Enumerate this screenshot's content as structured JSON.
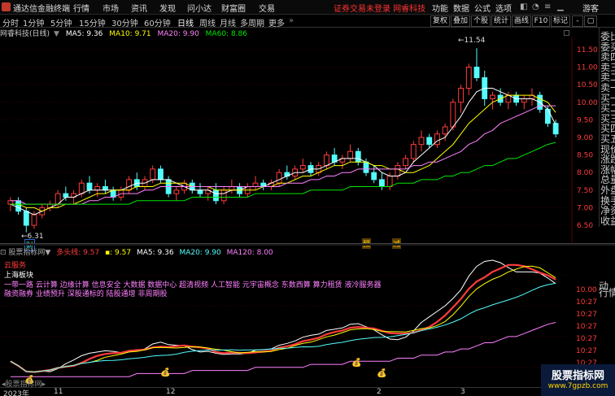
{
  "app": {
    "title": "通达信金融终端"
  },
  "menu": [
    "行情",
    "市场",
    "资讯",
    "发现",
    "问小达",
    "财富圈",
    "交易"
  ],
  "login_text": "证券交易未登录",
  "login_broker": "网睿科技",
  "menu_right": [
    "功能",
    "数据",
    "公式",
    "选项"
  ],
  "guest": "游客",
  "periods": [
    "分时",
    "1分钟",
    "5分钟",
    "15分钟",
    "30分钟",
    "60分钟",
    "日线",
    "周线",
    "月线",
    "多周期",
    "更多"
  ],
  "toolbar_right": [
    "复权",
    "叠加",
    "个股",
    "统计",
    "画线",
    "F10",
    "标记"
  ],
  "main_header": {
    "stock": "网睿科技(日线)",
    "ma5": "MA5: 9.36",
    "ma10": "MA10: 9.71",
    "ma20": "MA20: 9.90",
    "ma60": "MA60: 8.86"
  },
  "price_axis": [
    "11.50",
    "11.00",
    "10.50",
    "10.00",
    "9.50",
    "9.00",
    "8.50",
    "8.00",
    "7.50",
    "7.00",
    "6.50"
  ],
  "annotations": {
    "high": "11.54",
    "low": "6.31",
    "caibao": "财",
    "yu": "预",
    "jian": "减"
  },
  "right_labels": [
    "委比",
    "委买",
    "卖四",
    "卖三",
    "卖二",
    "卖一",
    "买一",
    "买二",
    "买三",
    "买四",
    "买五",
    "现价",
    "涨跌",
    "涨幅",
    "总量",
    "外盘",
    "换手",
    "净资",
    "收益"
  ],
  "low_header": {
    "name": "股票指标网",
    "indicator": "多头线",
    "v1": ": 9.57",
    "v2": ": 9.57",
    "ma5": "MA5: 9.36",
    "ma20": "MA20: 9.90",
    "ma120": "MA120: 8.00"
  },
  "low_overlay": {
    "l1": "云服务",
    "l2": "上海板块",
    "l3": "一带一路  云计算  边缘计算  信息安全  大数据  数据中心  超清视频  人工智能  元宇宙概念  东数西算  算力租赁  液冷服务器",
    "l4": "融资融券  业绩预升  深股通标的  陆股通增  非周期股"
  },
  "low_axis": [
    "10.00",
    "10:27",
    "10:27",
    "10:27",
    "10:27",
    "10:27",
    "10:27",
    "10:27",
    "10:27"
  ],
  "low_right": [
    "动",
    "行情"
  ],
  "bottom": {
    "year": "2023年",
    "m11": "11",
    "m12": "12",
    "m2": "2",
    "m3": "3",
    "pager": "股票指标网"
  },
  "watermark": {
    "line1": "股票指标网",
    "line2": "www.7gpzb.com"
  },
  "colors": {
    "up": "#ff3c3c",
    "down": "#54fcfc",
    "ma5": "#ffffff",
    "ma10": "#ffff00",
    "ma20": "#ff80ff",
    "ma60": "#00e600"
  },
  "chart_data": {
    "type": "candlestick",
    "ylim": [
      6.2,
      11.8
    ],
    "candles_ohlc": [
      [
        7.1,
        7.3,
        6.9,
        7.2
      ],
      [
        7.2,
        7.3,
        6.8,
        6.9
      ],
      [
        6.9,
        7.0,
        6.3,
        6.5
      ],
      [
        6.5,
        6.9,
        6.4,
        6.8
      ],
      [
        6.8,
        7.1,
        6.7,
        7.0
      ],
      [
        7.0,
        7.2,
        6.9,
        7.1
      ],
      [
        7.1,
        7.5,
        7.0,
        7.4
      ],
      [
        7.4,
        7.6,
        7.2,
        7.3
      ],
      [
        7.3,
        7.5,
        7.1,
        7.4
      ],
      [
        7.4,
        7.8,
        7.3,
        7.7
      ],
      [
        7.7,
        7.9,
        7.4,
        7.5
      ],
      [
        7.5,
        7.7,
        7.3,
        7.6
      ],
      [
        7.6,
        7.8,
        7.4,
        7.5
      ],
      [
        7.5,
        7.6,
        7.2,
        7.3
      ],
      [
        7.3,
        7.6,
        7.2,
        7.5
      ],
      [
        7.5,
        7.9,
        7.4,
        7.8
      ],
      [
        7.8,
        8.0,
        7.5,
        7.6
      ],
      [
        7.6,
        7.9,
        7.5,
        7.8
      ],
      [
        7.8,
        8.2,
        7.7,
        8.1
      ],
      [
        8.1,
        8.2,
        7.7,
        7.8
      ],
      [
        7.8,
        7.9,
        7.3,
        7.4
      ],
      [
        7.4,
        7.6,
        7.2,
        7.5
      ],
      [
        7.5,
        7.8,
        7.4,
        7.7
      ],
      [
        7.7,
        7.8,
        7.4,
        7.5
      ],
      [
        7.5,
        7.7,
        7.3,
        7.4
      ],
      [
        7.4,
        7.6,
        7.2,
        7.5
      ],
      [
        7.5,
        7.7,
        7.1,
        7.2
      ],
      [
        7.2,
        7.6,
        7.1,
        7.5
      ],
      [
        7.5,
        7.8,
        7.4,
        7.6
      ],
      [
        7.6,
        7.7,
        7.3,
        7.4
      ],
      [
        7.4,
        7.7,
        7.3,
        7.6
      ],
      [
        7.6,
        7.9,
        7.5,
        7.7
      ],
      [
        7.7,
        7.8,
        7.5,
        7.6
      ],
      [
        7.6,
        7.8,
        7.5,
        7.7
      ],
      [
        7.7,
        8.1,
        7.6,
        8.0
      ],
      [
        8.0,
        8.2,
        7.8,
        7.9
      ],
      [
        7.9,
        8.2,
        7.8,
        8.1
      ],
      [
        8.1,
        8.4,
        8.0,
        8.2
      ],
      [
        8.2,
        8.3,
        7.9,
        8.0
      ],
      [
        8.0,
        8.3,
        7.9,
        8.2
      ],
      [
        8.2,
        8.6,
        8.1,
        8.5
      ],
      [
        8.5,
        8.7,
        8.2,
        8.3
      ],
      [
        8.3,
        8.5,
        8.1,
        8.4
      ],
      [
        8.4,
        8.8,
        8.3,
        8.6
      ],
      [
        8.6,
        8.7,
        8.2,
        8.3
      ],
      [
        8.3,
        8.4,
        7.9,
        8.0
      ],
      [
        8.0,
        8.2,
        7.7,
        7.8
      ],
      [
        7.8,
        8.0,
        7.5,
        7.6
      ],
      [
        7.6,
        8.0,
        7.5,
        7.9
      ],
      [
        7.9,
        8.3,
        7.8,
        8.2
      ],
      [
        8.2,
        8.5,
        8.1,
        8.4
      ],
      [
        8.4,
        8.9,
        8.3,
        8.8
      ],
      [
        8.8,
        9.2,
        8.6,
        9.0
      ],
      [
        9.0,
        9.1,
        8.7,
        8.8
      ],
      [
        8.8,
        9.2,
        8.7,
        9.1
      ],
      [
        9.1,
        9.4,
        8.9,
        9.3
      ],
      [
        9.3,
        10.1,
        9.2,
        10.0
      ],
      [
        10.0,
        10.5,
        9.7,
        10.4
      ],
      [
        10.4,
        11.1,
        10.2,
        11.0
      ],
      [
        11.0,
        11.54,
        10.6,
        10.7
      ],
      [
        10.7,
        10.9,
        9.9,
        10.1
      ],
      [
        10.1,
        10.3,
        9.8,
        10.2
      ],
      [
        10.2,
        10.4,
        9.9,
        10.0
      ],
      [
        10.0,
        10.3,
        9.8,
        10.2
      ],
      [
        10.2,
        10.3,
        9.9,
        10.0
      ],
      [
        10.0,
        10.2,
        9.8,
        10.1
      ],
      [
        10.1,
        10.4,
        9.9,
        10.2
      ],
      [
        10.2,
        10.3,
        9.7,
        9.8
      ],
      [
        9.8,
        9.9,
        9.3,
        9.4
      ],
      [
        9.4,
        9.5,
        9.0,
        9.1
      ]
    ],
    "series": [
      {
        "name": "MA5",
        "values": [
          7.1,
          7.0,
          6.9,
          6.8,
          6.9,
          7.0,
          7.1,
          7.3,
          7.3,
          7.4,
          7.5,
          7.5,
          7.5,
          7.5,
          7.5,
          7.6,
          7.7,
          7.7,
          7.8,
          7.8,
          7.8,
          7.7,
          7.6,
          7.5,
          7.5,
          7.5,
          7.4,
          7.4,
          7.5,
          7.5,
          7.6,
          7.6,
          7.6,
          7.7,
          7.8,
          7.9,
          8.0,
          8.0,
          8.1,
          8.1,
          8.2,
          8.3,
          8.4,
          8.4,
          8.4,
          8.3,
          8.2,
          8.0,
          7.9,
          7.9,
          8.0,
          8.3,
          8.5,
          8.7,
          8.9,
          9.0,
          9.3,
          9.6,
          10.0,
          10.3,
          10.4,
          10.4,
          10.3,
          10.2,
          10.1,
          10.1,
          10.1,
          10.0,
          9.8,
          9.36
        ]
      },
      {
        "name": "MA10",
        "values": [
          7.1,
          7.1,
          7.0,
          7.0,
          6.9,
          7.0,
          7.0,
          7.1,
          7.1,
          7.2,
          7.3,
          7.4,
          7.4,
          7.5,
          7.5,
          7.5,
          7.6,
          7.6,
          7.6,
          7.7,
          7.7,
          7.7,
          7.7,
          7.6,
          7.6,
          7.6,
          7.5,
          7.5,
          7.5,
          7.5,
          7.5,
          7.5,
          7.6,
          7.6,
          7.7,
          7.7,
          7.8,
          7.9,
          7.9,
          8.0,
          8.1,
          8.2,
          8.2,
          8.3,
          8.3,
          8.3,
          8.2,
          8.2,
          8.1,
          8.1,
          8.0,
          8.0,
          8.1,
          8.2,
          8.4,
          8.6,
          8.8,
          9.1,
          9.4,
          9.6,
          9.8,
          10.0,
          10.1,
          10.2,
          10.2,
          10.2,
          10.2,
          10.1,
          10.0,
          9.71
        ]
      },
      {
        "name": "MA20",
        "values": [
          7.2,
          7.2,
          7.1,
          7.1,
          7.1,
          7.1,
          7.1,
          7.1,
          7.1,
          7.1,
          7.2,
          7.2,
          7.3,
          7.3,
          7.4,
          7.4,
          7.4,
          7.5,
          7.5,
          7.6,
          7.6,
          7.6,
          7.6,
          7.6,
          7.6,
          7.6,
          7.6,
          7.6,
          7.6,
          7.6,
          7.6,
          7.6,
          7.6,
          7.6,
          7.6,
          7.7,
          7.7,
          7.7,
          7.8,
          7.8,
          7.9,
          7.9,
          8.0,
          8.0,
          8.1,
          8.1,
          8.1,
          8.1,
          8.1,
          8.1,
          8.1,
          8.2,
          8.2,
          8.3,
          8.3,
          8.4,
          8.5,
          8.6,
          8.8,
          8.9,
          9.1,
          9.2,
          9.4,
          9.5,
          9.6,
          9.7,
          9.8,
          9.9,
          9.9,
          9.9
        ]
      },
      {
        "name": "MA60",
        "values": [
          7.1,
          7.1,
          7.1,
          7.1,
          7.1,
          7.1,
          7.1,
          7.1,
          7.1,
          7.1,
          7.1,
          7.1,
          7.1,
          7.1,
          7.1,
          7.1,
          7.2,
          7.2,
          7.2,
          7.2,
          7.2,
          7.2,
          7.2,
          7.3,
          7.3,
          7.3,
          7.3,
          7.3,
          7.3,
          7.3,
          7.3,
          7.4,
          7.4,
          7.4,
          7.4,
          7.4,
          7.4,
          7.4,
          7.5,
          7.5,
          7.5,
          7.5,
          7.5,
          7.6,
          7.6,
          7.6,
          7.6,
          7.6,
          7.6,
          7.7,
          7.7,
          7.7,
          7.8,
          7.8,
          7.8,
          7.9,
          7.9,
          8.0,
          8.0,
          8.1,
          8.2,
          8.2,
          8.3,
          8.4,
          8.4,
          8.5,
          8.6,
          8.7,
          8.8,
          8.86
        ]
      }
    ]
  }
}
